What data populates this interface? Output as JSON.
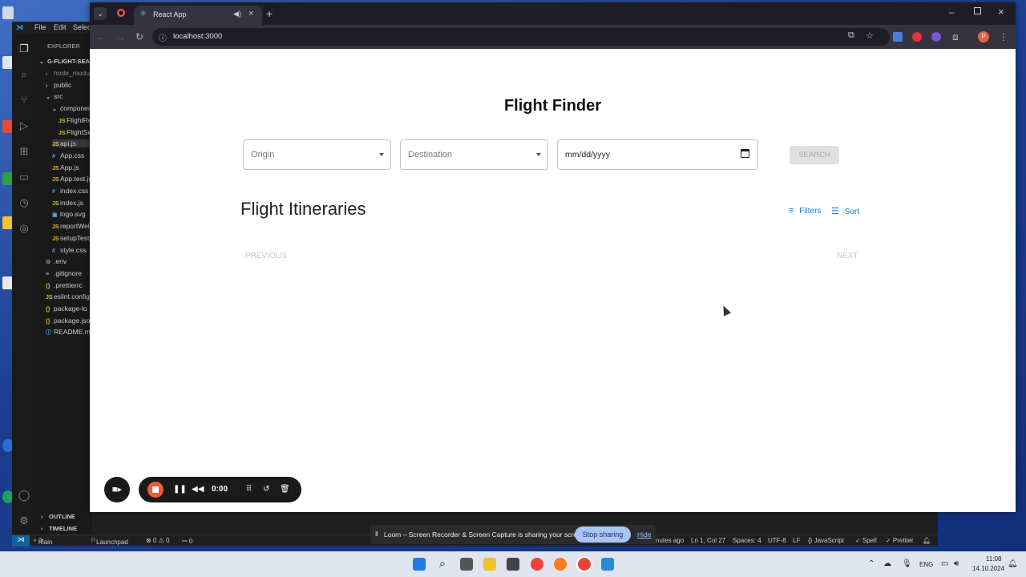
{
  "vscode": {
    "menu": [
      "File",
      "Edit",
      "Selec"
    ],
    "explorer_label": "EXPLORER",
    "project": "G-FLIGHT-SEAR",
    "tree": [
      {
        "label": "node_modu",
        "type": "folder",
        "indent": 1,
        "dim": true
      },
      {
        "label": "public",
        "type": "folder",
        "indent": 1
      },
      {
        "label": "src",
        "type": "folder-open",
        "indent": 1
      },
      {
        "label": "componen",
        "type": "folder-open",
        "indent": 2
      },
      {
        "label": "FlightRes",
        "type": "js",
        "indent": 3
      },
      {
        "label": "FlightSea",
        "type": "js",
        "indent": 3
      },
      {
        "label": "api.js",
        "type": "js",
        "indent": 2,
        "selected": true
      },
      {
        "label": "App.css",
        "type": "css",
        "indent": 2
      },
      {
        "label": "App.js",
        "type": "js",
        "indent": 2
      },
      {
        "label": "App.test.js",
        "type": "js",
        "indent": 2
      },
      {
        "label": "index.css",
        "type": "css",
        "indent": 2
      },
      {
        "label": "index.js",
        "type": "js",
        "indent": 2
      },
      {
        "label": "logo.svg",
        "type": "svg",
        "indent": 2
      },
      {
        "label": "reportWel",
        "type": "js",
        "indent": 2
      },
      {
        "label": "setupTests",
        "type": "js",
        "indent": 2
      },
      {
        "label": "style.css",
        "type": "css",
        "indent": 2
      },
      {
        "label": ".env",
        "type": "env",
        "indent": 1
      },
      {
        "label": ".gitignore",
        "type": "txt",
        "indent": 1
      },
      {
        "label": ".prettierrc",
        "type": "json",
        "indent": 1
      },
      {
        "label": "eslint.config",
        "type": "js",
        "indent": 1
      },
      {
        "label": "package-lo",
        "type": "json",
        "indent": 1
      },
      {
        "label": "package.jso",
        "type": "json",
        "indent": 1
      },
      {
        "label": "README.m",
        "type": "info",
        "indent": 1
      }
    ],
    "outline": "OUTLINE",
    "timeline": "TIMELINE",
    "status_left": [
      "main",
      "Launchpad",
      "⊗ 0 ⚠ 0",
      "ꟷ 0"
    ],
    "status_right": [
      "nutes ago",
      "Ln 1, Col 27",
      "Spaces: 4",
      "UTF-8",
      "LF",
      "{} JavaScript",
      "✓ Spell",
      "✓ Prettier"
    ]
  },
  "browser": {
    "tab_title": "React App",
    "url": "localhost:3000",
    "profile_initial": "P"
  },
  "app": {
    "title": "Flight Finder",
    "origin_label": "Origin",
    "destination_label": "Destination",
    "date_placeholder": "mm/dd/yyyy",
    "search_label": "SEARCH",
    "itineraries_title": "Flight Itineraries",
    "filters_label": "Filters",
    "sort_label": "Sort",
    "previous_label": "PREVIOUS",
    "next_label": "NEXT"
  },
  "loom": {
    "timer": "0:00",
    "sharing_text": "Loom – Screen Recorder & Screen Capture is sharing your screen.",
    "stop_sharing": "Stop sharing",
    "hide": "Hide"
  },
  "taskbar": {
    "language": "ENG",
    "time": "11:08",
    "date": "14.10.2024"
  },
  "colors": {
    "accent": "#1976d2",
    "chrome_frame": "#1e1c27",
    "chrome_toolbar": "#35333f",
    "vscode_bg": "#1f1f1f"
  }
}
